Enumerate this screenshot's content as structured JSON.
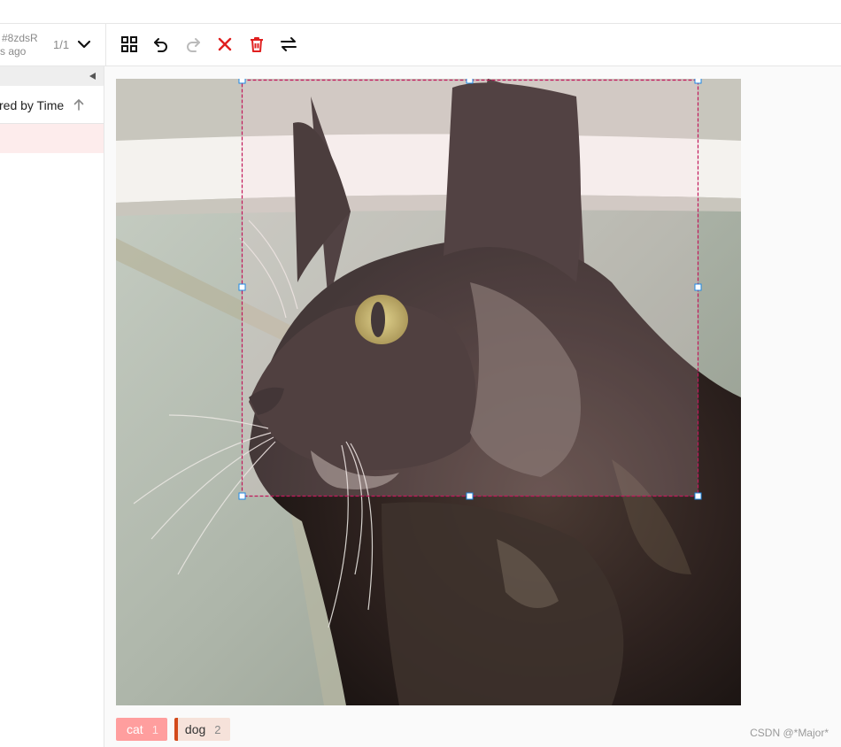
{
  "annotation": {
    "id": "#8zdsR",
    "time_ago": "s ago",
    "page": "1/1"
  },
  "toolbar": {
    "tools": [
      "grid-icon",
      "undo-icon",
      "redo-icon",
      "close-icon",
      "trash-icon",
      "swap-icon"
    ]
  },
  "sidebar": {
    "sort_label": "red by Time"
  },
  "labels": [
    {
      "name": "cat",
      "hotkey": "1",
      "color": "#ff9e9e"
    },
    {
      "name": "dog",
      "hotkey": "2",
      "color": "#d34a1c"
    }
  ],
  "region": {
    "label": "cat",
    "stroke_color": "#c2185b"
  },
  "watermark": "CSDN @*Major*"
}
